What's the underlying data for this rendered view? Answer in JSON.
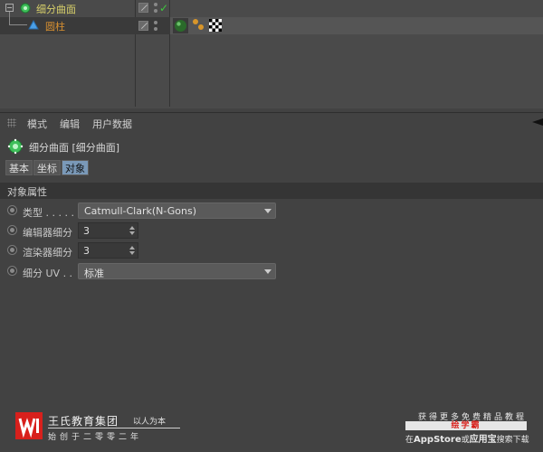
{
  "object_manager": {
    "objects": [
      {
        "name": "细分曲面",
        "expander": "−",
        "color": "#d8d06a"
      },
      {
        "name": "圆柱",
        "color": "#d89030"
      }
    ]
  },
  "attribute_manager": {
    "menu": [
      "模式",
      "编辑",
      "用户数据"
    ],
    "object_title": "细分曲面 [细分曲面]",
    "tabs": [
      {
        "label": "基本",
        "active": false
      },
      {
        "label": "坐标",
        "active": false
      },
      {
        "label": "对象",
        "active": true
      }
    ],
    "section_title": "对象属性",
    "properties": {
      "type": {
        "label": "类型 . . . . .",
        "value": "Catmull-Clark(N-Gons)"
      },
      "editor_subdiv": {
        "label": "编辑器细分",
        "value": "3"
      },
      "render_subdiv": {
        "label": "渲染器细分",
        "value": "3"
      },
      "uv_subdiv": {
        "label": "细分 UV . .",
        "value": "标准"
      }
    }
  },
  "watermark_left": {
    "logo_text": "W",
    "name": "王氏教育集团",
    "slogan": "以人为本",
    "since": "始创于二零零二年"
  },
  "watermark_right": {
    "line1": "获得更多免费精品教程",
    "line2": "绘学霸",
    "line3_prefix": "在",
    "line3_appstore": "AppStore",
    "line3_mid": "或",
    "line3_app": "应用宝",
    "line3_suffix": "搜索下载"
  },
  "colors": {
    "accent_tab": "#7a99b8",
    "active_object": "#d8d06a",
    "child_object": "#d89030",
    "logo_red": "#d8201c"
  }
}
